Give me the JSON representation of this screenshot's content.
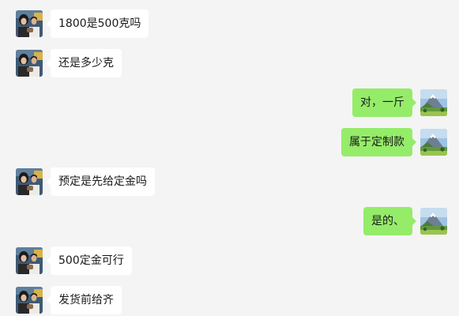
{
  "chat": {
    "messages": [
      {
        "direction": "incoming",
        "text": "1800是500克吗",
        "avatar": "couple-photo-avatar"
      },
      {
        "direction": "incoming",
        "text": "还是多少克",
        "avatar": "couple-photo-avatar"
      },
      {
        "direction": "outgoing",
        "text": "对，一斤",
        "avatar": "mountain-landscape-avatar"
      },
      {
        "direction": "outgoing",
        "text": "属于定制款",
        "avatar": "mountain-landscape-avatar"
      },
      {
        "direction": "incoming",
        "text": "预定是先给定金吗",
        "avatar": "couple-photo-avatar"
      },
      {
        "direction": "outgoing",
        "text": "是的、",
        "avatar": "mountain-landscape-avatar"
      },
      {
        "direction": "incoming",
        "text": "500定金可行",
        "avatar": "couple-photo-avatar"
      },
      {
        "direction": "incoming",
        "text": "发货前给齐",
        "avatar": "couple-photo-avatar"
      }
    ]
  },
  "colors": {
    "background": "#f4f4f4",
    "incoming_bubble": "#ffffff",
    "outgoing_bubble": "#95ec69",
    "text": "#1a1a1a"
  }
}
